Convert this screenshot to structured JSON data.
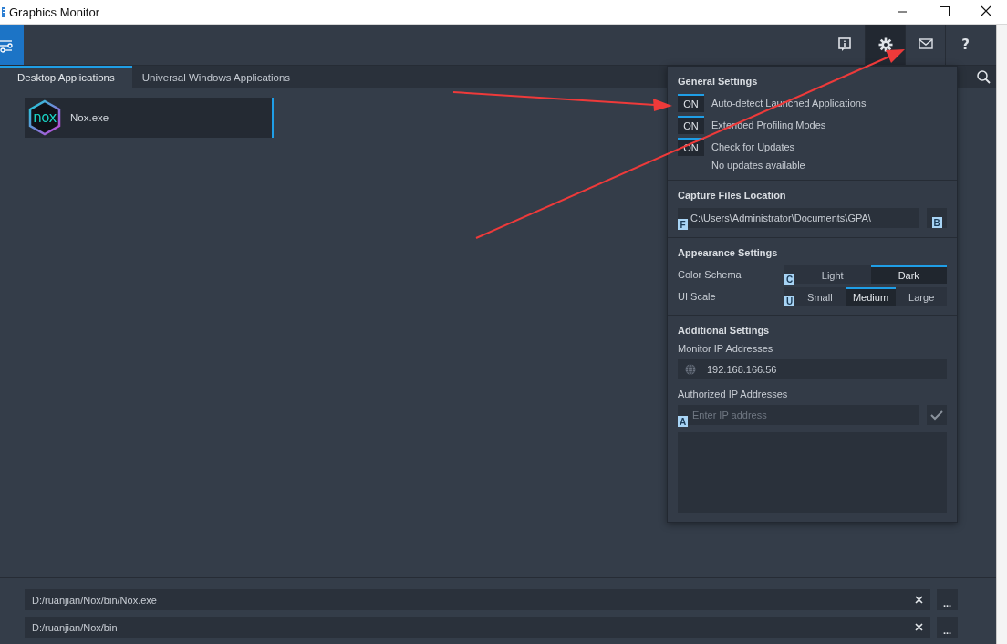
{
  "window": {
    "title": "Graphics Monitor"
  },
  "toolbar": {
    "buttons": [
      {
        "kind": "info",
        "selected": false
      },
      {
        "kind": "settings",
        "selected": true
      },
      {
        "kind": "mail",
        "selected": false
      },
      {
        "kind": "help",
        "label": "?",
        "selected": false
      }
    ]
  },
  "tabs": [
    {
      "label": "Desktop Applications",
      "selected": true
    },
    {
      "label": "Universal Windows Applications",
      "selected": false
    }
  ],
  "applications": [
    {
      "name": "Nox.exe",
      "logo": "nox",
      "selected": true
    }
  ],
  "settings": {
    "general": {
      "title": "General Settings",
      "toggles": [
        {
          "state": "ON",
          "label": "Auto-detect Launched Applications",
          "on": true
        },
        {
          "state": "ON",
          "label": "Extended Profiling Modes",
          "on": true
        },
        {
          "state": "ON",
          "label": "Check for Updates",
          "on": true
        }
      ],
      "update_status": "No updates available"
    },
    "capture": {
      "title": "Capture Files Location",
      "path": "C:\\Users\\Administrator\\Documents\\GPA\\",
      "path_key": "F",
      "browse_key": "B"
    },
    "appearance": {
      "title": "Appearance Settings",
      "groups": [
        {
          "label": "Color Schema",
          "key": "C",
          "options": [
            {
              "label": "Light",
              "selected": false
            },
            {
              "label": "Dark",
              "selected": true
            }
          ]
        },
        {
          "label": "UI Scale",
          "key": "U",
          "options": [
            {
              "label": "Small",
              "selected": false
            },
            {
              "label": "Medium",
              "selected": true
            },
            {
              "label": "Large",
              "selected": false
            }
          ]
        }
      ]
    },
    "additional": {
      "title": "Additional Settings",
      "monitor_label": "Monitor IP Addresses",
      "monitor_ip": "192.168.166.56",
      "authorized_label": "Authorized IP Addresses",
      "ip_placeholder": "Enter IP address",
      "ip_key": "A"
    }
  },
  "paths": [
    {
      "value": "D:/ruanjian/Nox/bin/Nox.exe",
      "browse_label": "..."
    },
    {
      "value": "D:/ruanjian/Nox/bin",
      "browse_label": "..."
    }
  ]
}
